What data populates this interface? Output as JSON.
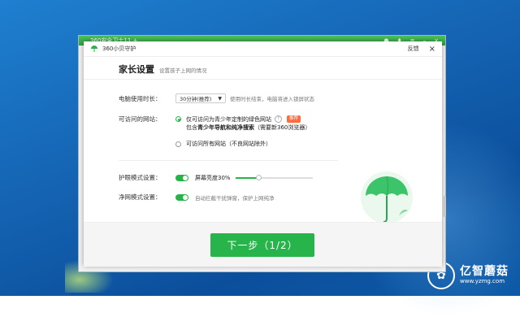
{
  "background_window": {
    "title": "360安全卫士11.+"
  },
  "dialog": {
    "title": "360小贝守护",
    "feedback": "反馈",
    "close": "×"
  },
  "header": {
    "title": "家长设置",
    "subtitle": "设置孩子上网的情况"
  },
  "usage_time": {
    "label": "电脑使用时长：",
    "selected": "30分钟(推荐)",
    "hint": "使用时长结束，电脑将进入锁屏状态"
  },
  "websites": {
    "label": "可访问的网站：",
    "option1": "仅可访问为青少年定制的绿色网站",
    "badge": "推荐",
    "option1_sub_prefix": "包含",
    "option1_sub_bold": "青少年导航和纯净搜索",
    "option1_sub_suffix": "（需要新360浏览器）",
    "option2": "可访问所有网站（不良网站除外）"
  },
  "eye_mode": {
    "label": "护眼模式设置：",
    "text": "屏幕亮度30%",
    "brightness_percent": 30
  },
  "net_mode": {
    "label": "净网模式设置：",
    "text": "自动拦截干扰弹窗，保护上网纯净"
  },
  "next_button": "下一步（1/2）",
  "watermark": {
    "brand": "亿智蘑菇",
    "url": "www.yzmg.com"
  },
  "colors": {
    "accent": "#27b54b",
    "badge": "#ff6b3d"
  }
}
